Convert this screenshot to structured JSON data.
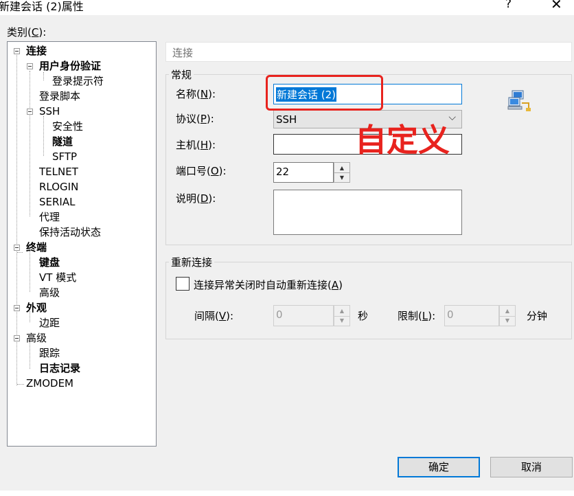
{
  "window": {
    "title": "新建会话 (2)属性",
    "help_glyph": "?",
    "close_glyph": "✕"
  },
  "category": {
    "label": "类别(",
    "accel": "C",
    "label_end": "):"
  },
  "tree": {
    "items": [
      {
        "label": "连接"
      },
      {
        "label": "用户身份验证"
      },
      {
        "label": "登录提示符"
      },
      {
        "label": "登录脚本"
      },
      {
        "label": "SSH"
      },
      {
        "label": "安全性"
      },
      {
        "label": "隧道"
      },
      {
        "label": "SFTP"
      },
      {
        "label": "TELNET"
      },
      {
        "label": "RLOGIN"
      },
      {
        "label": "SERIAL"
      },
      {
        "label": "代理"
      },
      {
        "label": "保持活动状态"
      },
      {
        "label": "终端"
      },
      {
        "label": "键盘"
      },
      {
        "label": "VT 模式"
      },
      {
        "label": "高级"
      },
      {
        "label": "外观"
      },
      {
        "label": "边距"
      },
      {
        "label": "高级"
      },
      {
        "label": "跟踪"
      },
      {
        "label": "日志记录"
      },
      {
        "label": "ZMODEM"
      }
    ]
  },
  "panel": {
    "header": "连接",
    "general": {
      "title": "常规",
      "name": {
        "label": "名称(",
        "accel": "N",
        "end": "):",
        "value": "新建会话 (2)"
      },
      "protocol": {
        "label": "协议(",
        "accel": "P",
        "end": "):",
        "value": "SSH",
        "arrow": "⌵"
      },
      "host": {
        "label": "主机(",
        "accel": "H",
        "end": "):",
        "value": ""
      },
      "port": {
        "label": "端口号(",
        "accel": "O",
        "end": "):",
        "value": "22"
      },
      "description": {
        "label": "说明(",
        "accel": "D",
        "end": "):",
        "value": ""
      }
    },
    "reconnect": {
      "title": "重新连接",
      "checkbox": {
        "label": "连接异常关闭时自动重新连接(",
        "accel": "A",
        "end": ")",
        "checked": false
      },
      "interval": {
        "label": "间隔(",
        "accel": "V",
        "end": "):",
        "value": "0",
        "unit": "秒"
      },
      "limit": {
        "label": "限制(",
        "accel": "L",
        "end": "):",
        "value": "0",
        "unit": "分钟"
      }
    }
  },
  "buttons": {
    "ok": "确定",
    "cancel": "取消"
  },
  "annotation": {
    "text": "自定义",
    "color": "#e8231e"
  },
  "colors": {
    "selection": "#0078d7",
    "accent_border": "#0078d7"
  }
}
